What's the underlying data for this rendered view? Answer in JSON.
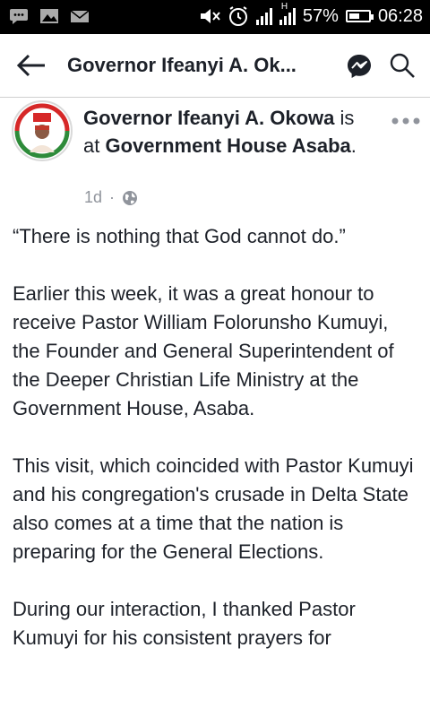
{
  "status_bar": {
    "battery_percent": "57%",
    "time": "06:28",
    "battery_level": 0.57
  },
  "header": {
    "title": "Governor Ifeanyi A. Ok..."
  },
  "post": {
    "author": "Governor Ifeanyi A. Okowa",
    "is_at": "is at",
    "location": "Government House Asaba",
    "period": ".",
    "time_ago": "1d",
    "separator": "·",
    "paragraphs": [
      "“There is nothing that God cannot do.”",
      "Earlier this week, it was a great honour to receive Pastor William Folorunsho Kumuyi, the Founder and General Superintendent of the Deeper Christian Life Ministry at the Government House, Asaba.",
      "This visit, which coincided with Pastor Kumuyi and his congregation's crusade in Delta State also comes at a time that the nation is preparing for the General Elections.",
      "During our interaction, I thanked Pastor Kumuyi for his consistent prayers for"
    ]
  },
  "colors": {
    "status_bar_bg": "#000000",
    "text": "#1d2129",
    "meta_gray": "#90949c",
    "messenger_blue": "#1d2129"
  }
}
